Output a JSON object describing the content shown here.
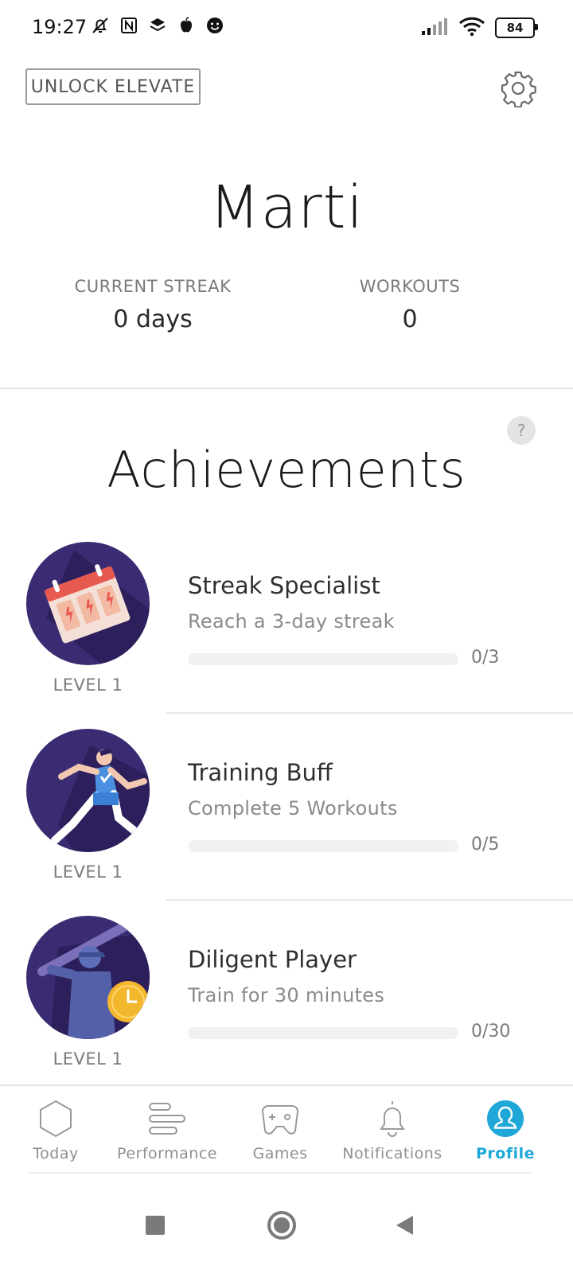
{
  "status_bar": {
    "time": "19:27",
    "battery": "84",
    "icons": [
      "bell-off-icon",
      "nfc-icon",
      "layers-icon",
      "apple-icon",
      "smiley-icon",
      "signal-icon",
      "wifi-icon"
    ]
  },
  "header": {
    "unlock_label": "UNLOCK ELEVATE",
    "settings_icon": "gear-icon"
  },
  "profile": {
    "name": "Marti",
    "stats": [
      {
        "label": "CURRENT STREAK",
        "value": "0 days"
      },
      {
        "label": "WORKOUTS",
        "value": "0"
      }
    ]
  },
  "achievements": {
    "title": "Achievements",
    "help_label": "?",
    "items": [
      {
        "title": "Streak Specialist",
        "description": "Reach a 3-day streak",
        "level": "LEVEL 1",
        "progress_text": "0/3",
        "progress": 0,
        "badge": "calendar-badge-icon"
      },
      {
        "title": "Training Buff",
        "description": "Complete 5 Workouts",
        "level": "LEVEL 1",
        "progress_text": "0/5",
        "progress": 0,
        "badge": "runner-badge-icon"
      },
      {
        "title": "Diligent Player",
        "description": "Train for 30 minutes",
        "level": "LEVEL 1",
        "progress_text": "0/30",
        "progress": 0,
        "badge": "batter-clock-badge-icon"
      }
    ]
  },
  "bottom_nav": {
    "items": [
      {
        "label": "Today",
        "icon": "hexagon-icon",
        "active": false
      },
      {
        "label": "Performance",
        "icon": "bars-icon",
        "active": false
      },
      {
        "label": "Games",
        "icon": "gamepad-icon",
        "active": false
      },
      {
        "label": "Notifications",
        "icon": "bell-icon",
        "active": false
      },
      {
        "label": "Profile",
        "icon": "profile-icon",
        "active": true
      }
    ]
  },
  "colors": {
    "accent": "#1ea7d7",
    "badge_background": "#3b2b72",
    "text_muted": "#7a7a7a"
  }
}
